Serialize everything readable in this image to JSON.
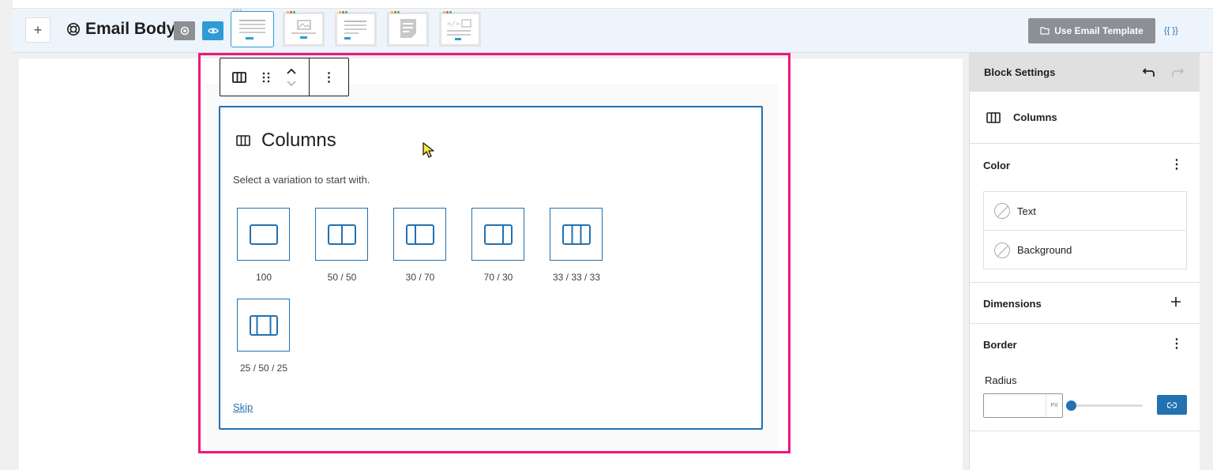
{
  "header": {
    "add_label": "+",
    "title": "Email Body",
    "use_template_label": "Use Email Template",
    "merge_tags_label": "{{ }}"
  },
  "toolbar": {
    "more_label": "⋮"
  },
  "placeholder": {
    "title": "Columns",
    "instructions": "Select a variation to start with.",
    "variations": [
      {
        "label": "100"
      },
      {
        "label": "50 / 50"
      },
      {
        "label": "30 / 70"
      },
      {
        "label": "70 / 30"
      },
      {
        "label": "33 / 33 / 33"
      },
      {
        "label": "25 / 50 / 25"
      }
    ],
    "skip_label": "Skip"
  },
  "sidebar": {
    "title": "Block Settings",
    "block_name": "Columns",
    "color_label": "Color",
    "text_label": "Text",
    "background_label": "Background",
    "dimensions_label": "Dimensions",
    "border_label": "Border",
    "radius_label": "Radius",
    "radius_unit": "PX",
    "radius_value": ""
  },
  "colors": {
    "accent": "#2271b1",
    "highlight": "#f0167f"
  }
}
